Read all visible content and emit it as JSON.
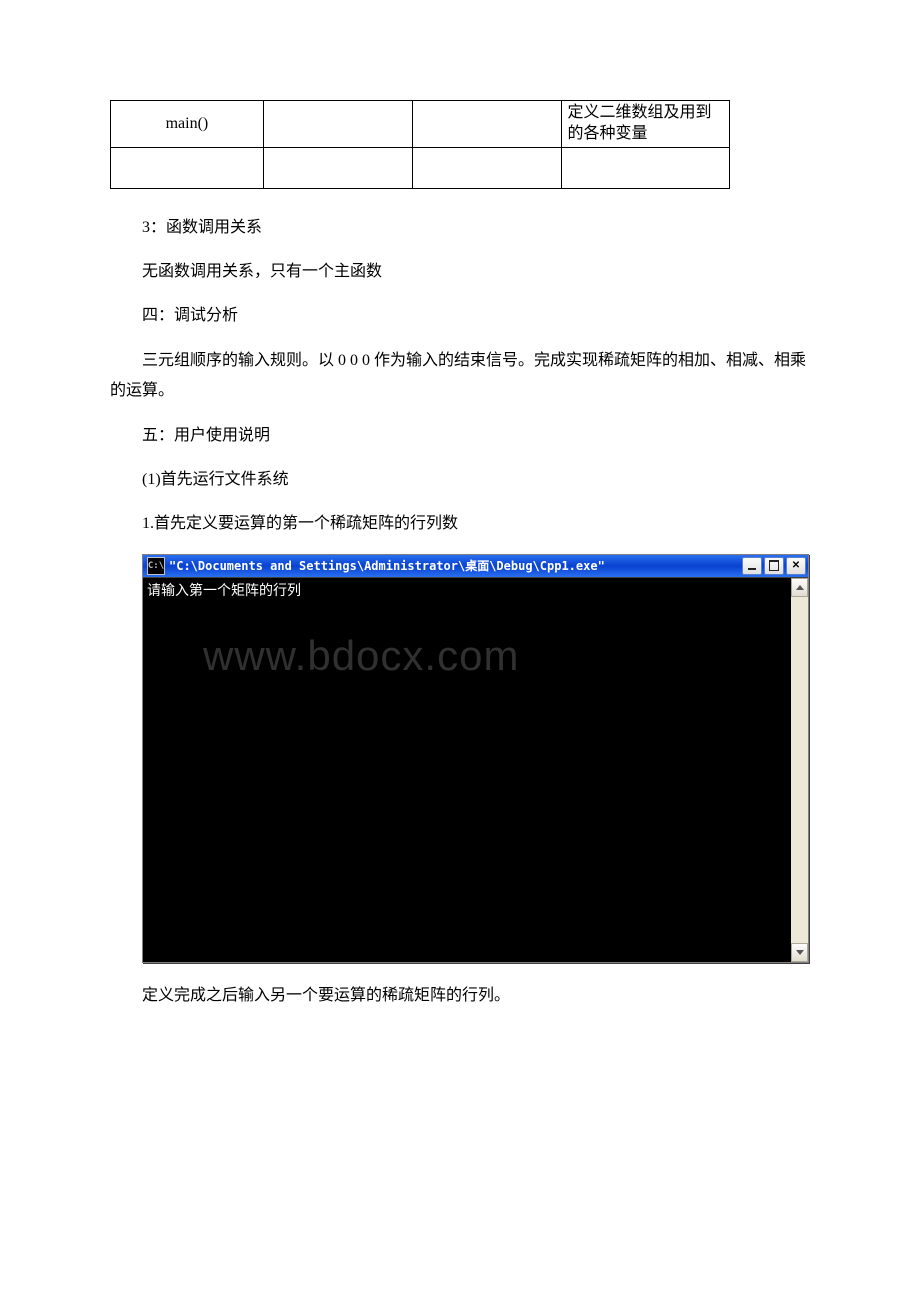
{
  "table": {
    "r1": {
      "c1": "main()",
      "c2": "",
      "c3": "",
      "c4": "定义二维数组及用到的各种变量"
    },
    "r2": {
      "c1": "",
      "c2": "",
      "c3": "",
      "c4": ""
    }
  },
  "paragraphs": {
    "p1": "3：函数调用关系",
    "p2": "无函数调用关系，只有一个主函数",
    "p3": "四：调试分析",
    "p4": "三元组顺序的输入规则。以 0 0 0 作为输入的结束信号。完成实现稀疏矩阵的相加、相减、相乘的运算。",
    "p5": "五：用户使用说明",
    "p6": "(1)首先运行文件系统",
    "p7": "1.首先定义要运算的第一个稀疏矩阵的行列数",
    "p8": "定义完成之后输入另一个要运算的稀疏矩阵的行列。"
  },
  "console": {
    "icon_label": "C:\\",
    "title": "\"C:\\Documents and Settings\\Administrator\\桌面\\Debug\\Cpp1.exe\"",
    "prompt": "请输入第一个矩阵的行列",
    "watermark": "www.bdocx.com"
  }
}
